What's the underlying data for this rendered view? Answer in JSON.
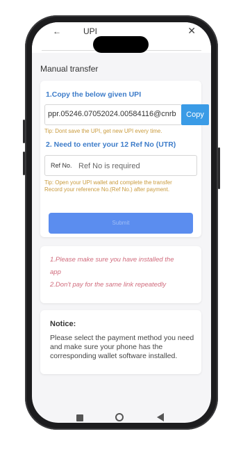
{
  "header": {
    "back_label": "←",
    "title": "UPI",
    "close_label": "✕"
  },
  "section_title": "Manual transfer",
  "upi_card": {
    "step1_label": "1.Copy the below given UPI",
    "upi_value": "ppr.05246.07052024.00584116@cnrb",
    "copy_button": "Copy",
    "tip1": "Tip: Dont save the UPI, get new UPI every time.",
    "step2_label": "2. Need to enter your 12 Ref No (UTR)",
    "ref_label": "Ref No.",
    "ref_placeholder": "Ref No is required",
    "ref_value": "",
    "tip2_line1": "Tip: Open your UPI wallet and complete the transfer",
    "tip2_line2": "Record your reference No.(Ref No.) after payment.",
    "submit_button": "Submit"
  },
  "warnings": {
    "line1": "1.Please make sure you have installed the",
    "line2": "app",
    "line3": "2.Don't pay for the same link repeatedly"
  },
  "notice": {
    "title": "Notice:",
    "text": "Please select the payment method you need and make sure your phone has the corresponding wallet software installed."
  },
  "colors": {
    "step_blue": "#3d7cc9",
    "copy_button": "#3a9be6",
    "submit_button": "#5b8def",
    "tip_text": "#c99a3c",
    "warning_text": "#d06b7c"
  },
  "icons": {
    "back": "arrow-left-icon",
    "close": "close-icon",
    "nav_recents": "square-icon",
    "nav_home": "circle-icon",
    "nav_back": "triangle-back-icon"
  }
}
